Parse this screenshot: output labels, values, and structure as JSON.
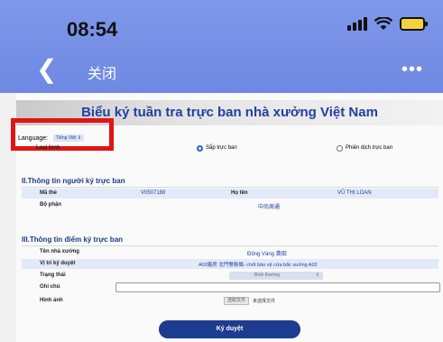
{
  "status_bar": {
    "time": "08:54"
  },
  "nav": {
    "back_icon": "chevron-left-icon",
    "close_label": "关闭",
    "more_icon": "more-dots-icon"
  },
  "form": {
    "title": "Biểu ký tuần tra trực ban nhà xưởng Việt Nam",
    "language_label": "Language:",
    "language_value": "Tiếng Việt ⇕",
    "loai_hinh_label": "Loại hình",
    "option_1": "Sắp trực ban",
    "option_2": "Phiên dịch trực ban",
    "section2": {
      "title": "II.Thông tin người ký trực ban",
      "ma_the_label": "Mã thẻ",
      "ma_the_value": "V0507188",
      "ho_ten_label": "Họ tên",
      "ho_ten_value": "VŨ THỊ LOAN",
      "bo_phan_label": "Bộ phận",
      "bo_phan_value": "中尚周通"
    },
    "section3": {
      "title": "III.Thông tin điểm ký trực ban",
      "ten_nha_xuong_label": "Tên nhà xưởng",
      "ten_nha_xuong_value": "Đông Vàng 黃田",
      "vi_tri_label": "Vị trí ký duyệt",
      "vi_tri_value": "A02廠房 北門警衛崗- chốt bảo vệ cửa bắc xưởng A02",
      "trang_thai_label": "Trạng thái",
      "trang_thai_value": "Bình thường",
      "ghi_chu_label": "Ghi chú",
      "hinh_anh_label": "Hình ảnh",
      "file_button": "选取文件",
      "file_status": "未选择文件"
    },
    "submit_label": "Ký duyệt"
  },
  "colors": {
    "header": "#7e98ea",
    "accent": "#1d3b8f",
    "highlight": "#e01515"
  }
}
